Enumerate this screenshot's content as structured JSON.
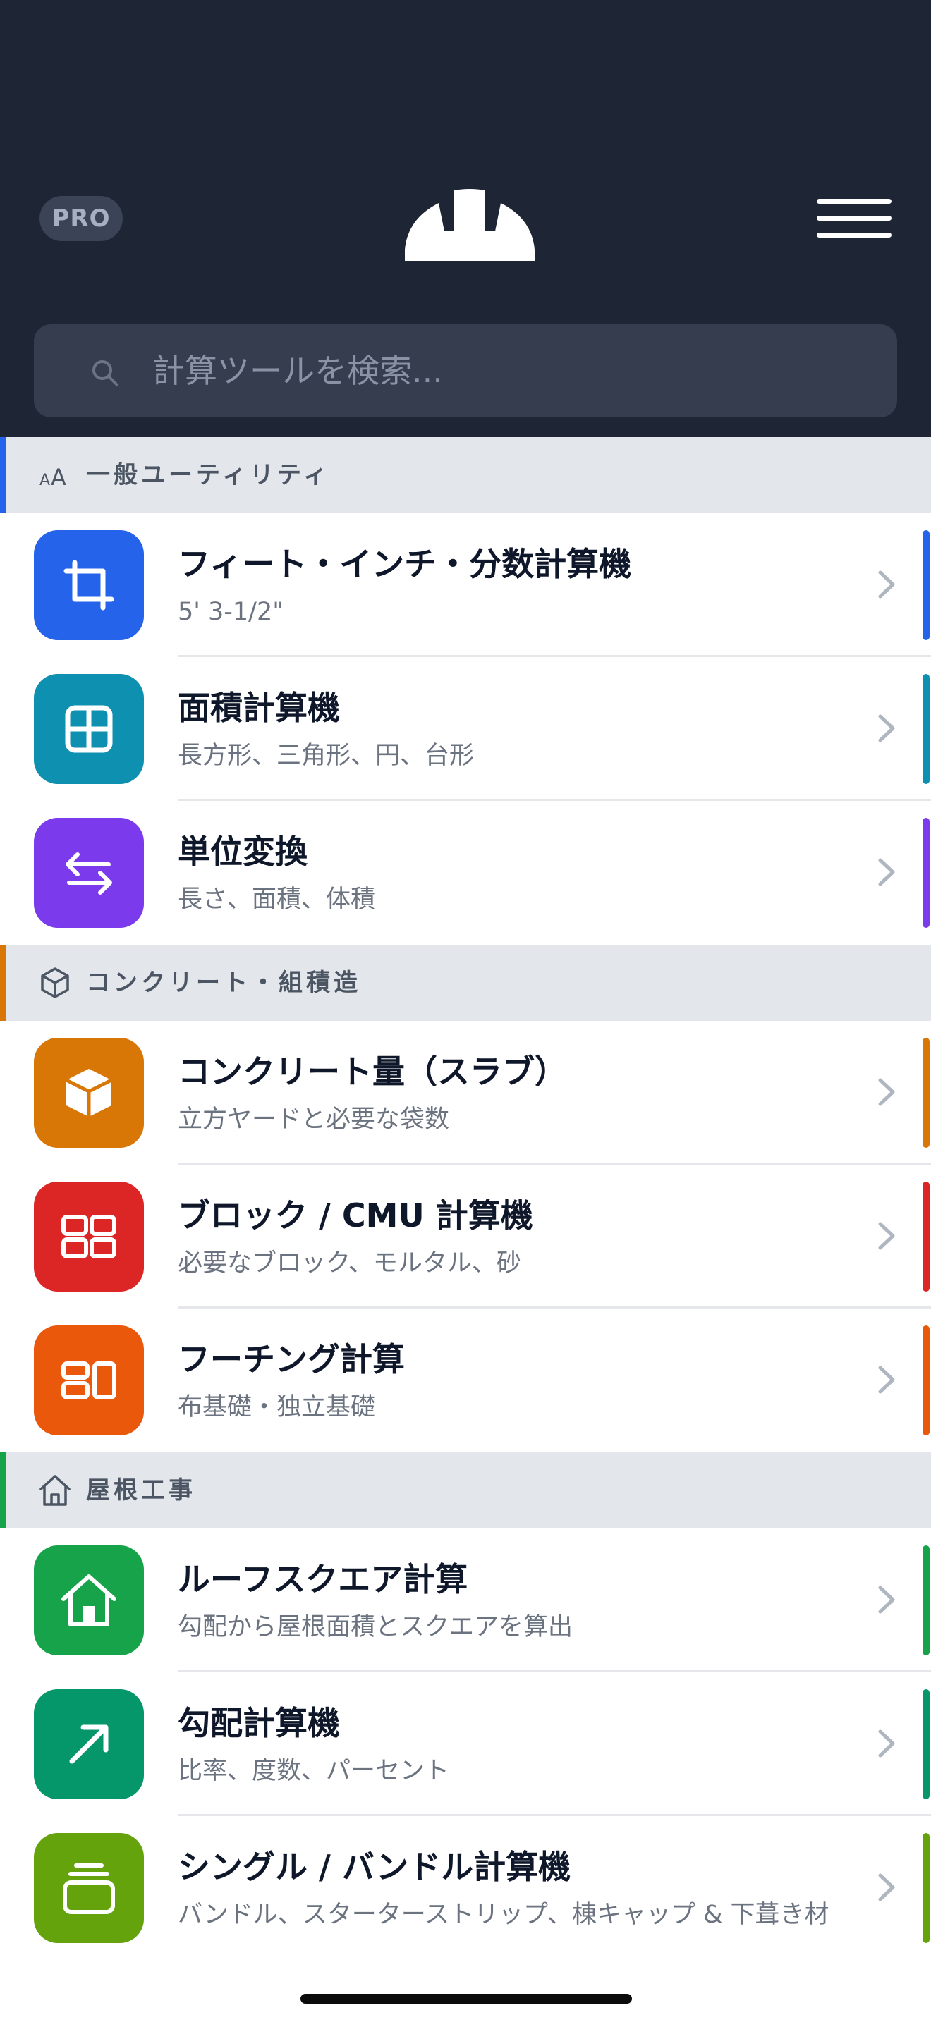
{
  "header": {
    "pro_label": "PRO",
    "logo_icon": "hard-hat-icon",
    "menu_icon": "hamburger-menu-icon",
    "background": "#1e2535"
  },
  "search": {
    "placeholder": "計算ツールを検索...",
    "value": "",
    "icon": "search-icon"
  },
  "sections": [
    {
      "title": "一般ユーティリティ",
      "icon": "text-size-icon",
      "accent": "#2563eb",
      "items": [
        {
          "title": "フィート・インチ・分数計算機",
          "subtitle": "5' 3-1/2\"",
          "icon": "crop-icon",
          "color": "#2563eb"
        },
        {
          "title": "面積計算機",
          "subtitle": "長方形、三角形、円、台形",
          "icon": "grid-icon",
          "color": "#0e90b0"
        },
        {
          "title": "単位変換",
          "subtitle": "長さ、面積、体積",
          "icon": "arrows-exchange-icon",
          "color": "#7c3aed"
        }
      ]
    },
    {
      "title": "コンクリート・組積造",
      "icon": "cube-icon",
      "accent": "#d97706",
      "items": [
        {
          "title": "コンクリート量（スラブ）",
          "subtitle": "立方ヤードと必要な袋数",
          "icon": "box-icon",
          "color": "#d97706"
        },
        {
          "title": "ブロック / CMU 計算機",
          "subtitle": "必要なブロック、モルタル、砂",
          "icon": "blocks-icon",
          "color": "#dc2626"
        },
        {
          "title": "フーチング計算",
          "subtitle": "布基礎・独立基礎",
          "icon": "footing-icon",
          "color": "#ea580c"
        }
      ]
    },
    {
      "title": "屋根工事",
      "icon": "house-outline-icon",
      "accent": "#16a34a",
      "items": [
        {
          "title": "ルーフスクエア計算",
          "subtitle": "勾配から屋根面積とスクエアを算出",
          "icon": "house-icon",
          "color": "#16a34a"
        },
        {
          "title": "勾配計算機",
          "subtitle": "比率、度数、パーセント",
          "icon": "arrow-up-right-icon",
          "color": "#059669"
        },
        {
          "title": "シングル / バンドル計算機",
          "subtitle": "バンドル、スターターストリップ、棟キャップ & 下葺き材",
          "icon": "stack-icon",
          "color": "#65a30d"
        }
      ]
    }
  ]
}
